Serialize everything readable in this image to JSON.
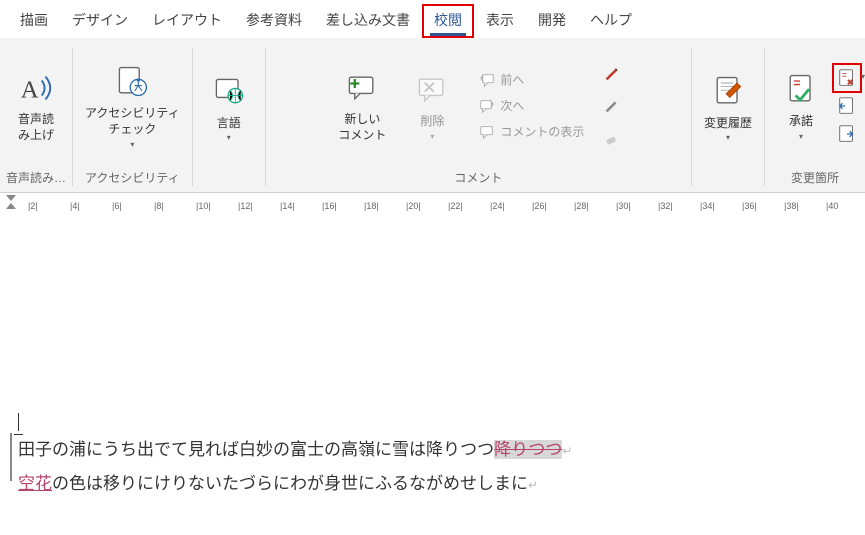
{
  "tabs": {
    "drawing": "描画",
    "design": "デザイン",
    "layout": "レイアウト",
    "references": "参考資料",
    "mailings": "差し込み文書",
    "review": "校閲",
    "view": "表示",
    "developer": "開発",
    "help": "ヘルプ"
  },
  "ribbon": {
    "speech": {
      "label": "音声読\nみ上げ",
      "group": "音声読み…"
    },
    "accessibility": {
      "label": "アクセシビリティ\nチェック",
      "group": "アクセシビリティ"
    },
    "language": {
      "label": "言語"
    },
    "comments": {
      "new": "新しい\nコメント",
      "delete": "削除",
      "prev": "前へ",
      "next": "次へ",
      "show": "コメントの表示",
      "group": "コメント"
    },
    "tracking": {
      "label": "変更履歴"
    },
    "accept": {
      "label": "承諾"
    },
    "changes_group": "変更箇所"
  },
  "ruler": {
    "marks": [
      "|2|",
      "|4|",
      "|6|",
      "|8|",
      "|10|",
      "|12|",
      "|14|",
      "|16|",
      "|18|",
      "|20|",
      "|22|",
      "|24|",
      "|26|",
      "|28|",
      "|30|",
      "|32|",
      "|34|",
      "|36|",
      "|38|",
      "|40"
    ]
  },
  "document": {
    "line1_pre": "田子の浦にうち出でて見れば白妙の富士の高嶺に雪は降りつつ",
    "line1_del": "降りつつ",
    "line2_ins": "空花",
    "line2_rest": "の色は移りにけりないたづらにわが身世にふるながめせしまに"
  }
}
